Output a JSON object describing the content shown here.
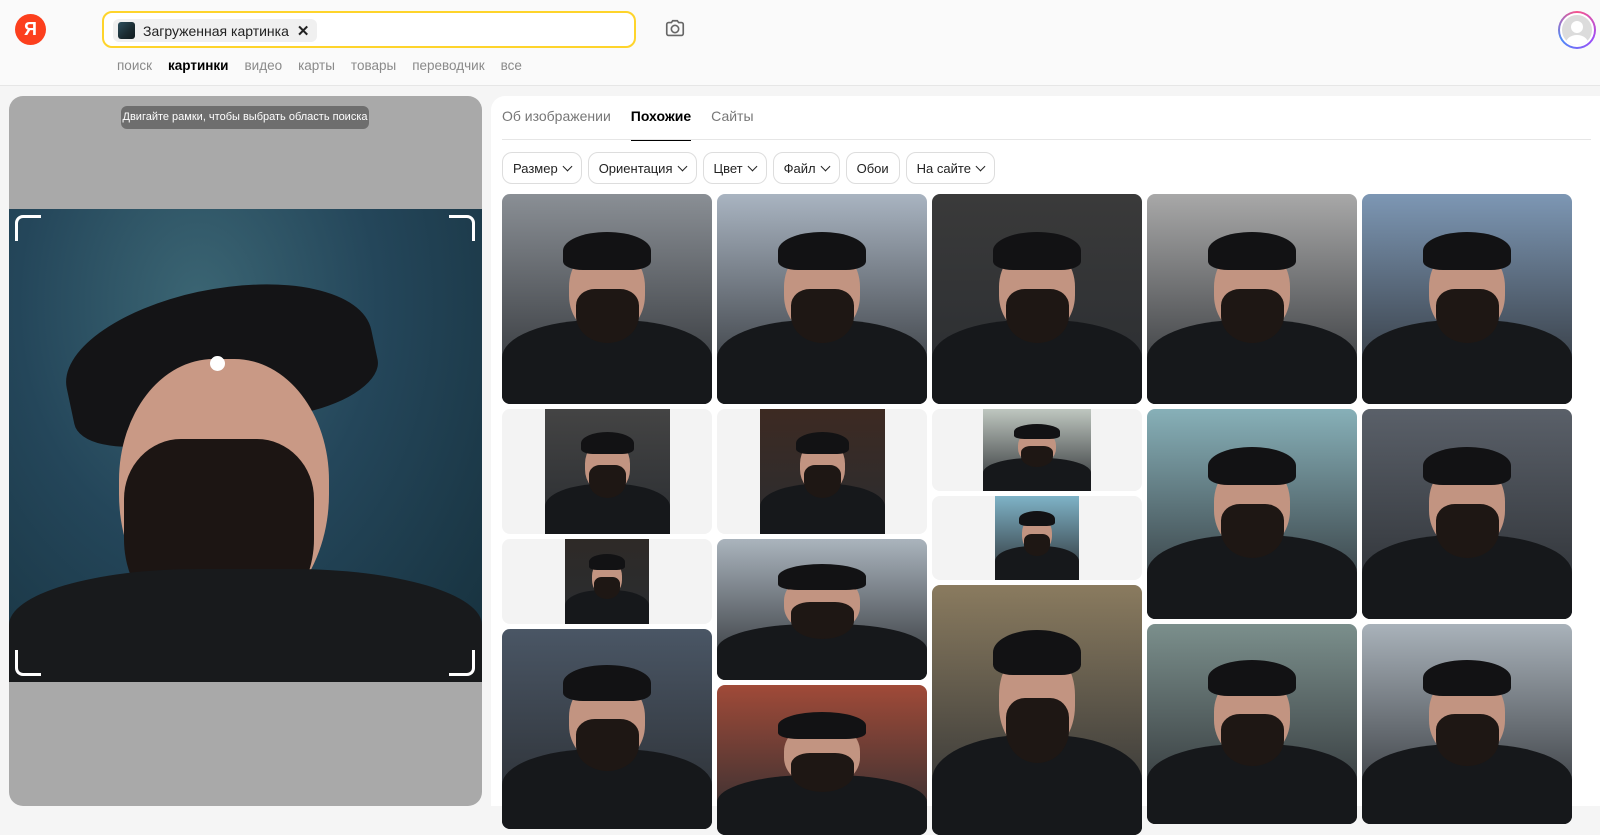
{
  "header": {
    "logo": "Я",
    "search_chip_label": "Загруженная картинка",
    "search_chip_close": "✕",
    "nav": [
      "поиск",
      "картинки",
      "видео",
      "карты",
      "товары",
      "переводчик",
      "все"
    ],
    "nav_active_index": 1
  },
  "left_panel": {
    "hint": "Двигайте рамки, чтобы выбрать область поиска"
  },
  "right_panel": {
    "tabs": [
      "Об изображении",
      "Похожие",
      "Сайты"
    ],
    "active_tab_index": 1,
    "filters": [
      {
        "label": "Размер",
        "dropdown": true
      },
      {
        "label": "Ориентация",
        "dropdown": true
      },
      {
        "label": "Цвет",
        "dropdown": true
      },
      {
        "label": "Файл",
        "dropdown": true
      },
      {
        "label": "Обои",
        "dropdown": false
      },
      {
        "label": "На сайте",
        "dropdown": true
      }
    ]
  },
  "colors": {
    "logo": "#fc3f1d",
    "search_border": "#fed42b"
  },
  "results": [
    {
      "sky": "#8a8f95",
      "tone": "building"
    },
    {
      "sky": "#a9b4c1",
      "tone": "sky"
    },
    {
      "sky": "#3a3a3a",
      "tone": "dark"
    },
    {
      "sky": "#a8a8a8",
      "tone": "grey"
    },
    {
      "sky": "#7d97b4",
      "tone": "cloud"
    },
    {
      "sky": "#444444",
      "tone": "hood"
    },
    {
      "sky": "#3d2a22",
      "tone": "street"
    },
    {
      "sky": "#bfc7c0",
      "tone": "light"
    },
    {
      "sky": "#7fb3c7",
      "tone": "blue"
    },
    {
      "sky": "#87b0b8",
      "tone": "teal"
    },
    {
      "sky": "#5a6069",
      "tone": "cloudy"
    },
    {
      "sky": "#2e2a27",
      "tone": "dark"
    },
    {
      "sky": "#aab4bd",
      "tone": "sky"
    },
    {
      "sky": "#4a5665",
      "tone": "night"
    },
    {
      "sky": "#8a7b5f",
      "tone": "forest"
    },
    {
      "sky": "#7b8f8c",
      "tone": "field"
    },
    {
      "sky": "#a9b2ba",
      "tone": "sea"
    },
    {
      "sky": "#a04a38",
      "tone": "brick"
    }
  ]
}
